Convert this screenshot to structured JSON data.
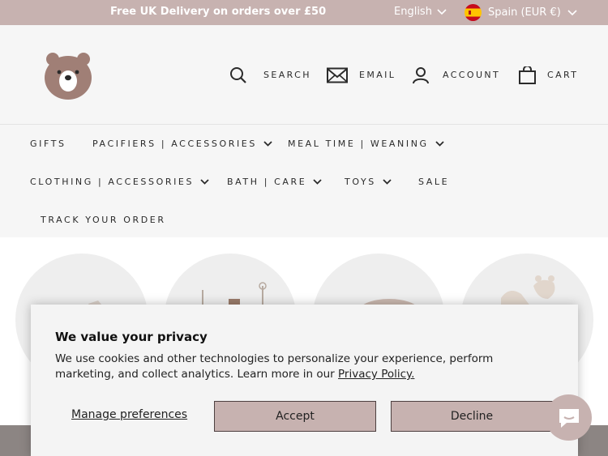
{
  "announcement": {
    "message": "Free UK Delivery on orders over £50",
    "language": "English",
    "country": "Spain (EUR €)"
  },
  "header": {
    "nav": {
      "search": "SEARCH",
      "email": "EMAIL",
      "account": "ACCOUNT",
      "cart": "CART"
    }
  },
  "menu": {
    "items": [
      {
        "label": "GIFTS"
      },
      {
        "label": "PACIFIERS | ACCESSORIES"
      },
      {
        "label": "MEAL TIME | WEANING"
      },
      {
        "label": "CLOTHING | ACCESSORIES"
      },
      {
        "label": "BATH | CARE"
      },
      {
        "label": "TOYS"
      },
      {
        "label": "SALE"
      },
      {
        "label": "TRACK YOUR ORDER"
      }
    ]
  },
  "cookie_banner": {
    "title": "We value your privacy",
    "body": "We use cookies and other technologies to personalize your experience, perform marketing, and collect analytics. Learn more in our ",
    "policy_link": "Privacy Policy.",
    "manage_label": "Manage preferences",
    "accept_label": "Accept",
    "decline_label": "Decline"
  },
  "colors": {
    "accent": "#c7b2b0",
    "logo": "#a07f76",
    "text": "#2b2b2b"
  }
}
